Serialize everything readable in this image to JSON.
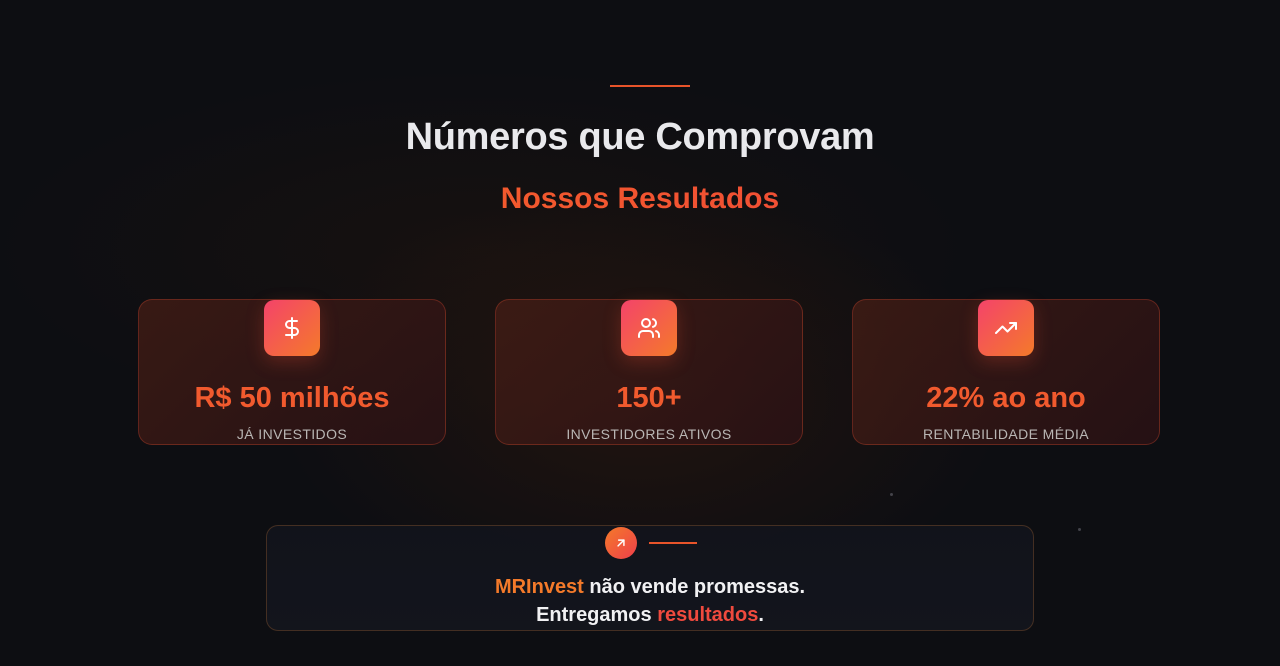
{
  "section": {
    "title": "Números que Comprovam",
    "subtitle": "Nossos Resultados"
  },
  "stats": [
    {
      "icon": "dollar-icon",
      "value": "R$ 50 milhões",
      "label": "JÁ INVESTIDOS"
    },
    {
      "icon": "users-icon",
      "value": "150+",
      "label": "INVESTIDORES ATIVOS"
    },
    {
      "icon": "trending-up-icon",
      "value": "22% ao ano",
      "label": "RENTABILIDADE MÉDIA"
    }
  ],
  "statement": {
    "icon": "arrow-up-right-icon",
    "brand": "MRInvest",
    "line1_rest": " não vende promessas.",
    "line2_start": "Entregamos ",
    "line2_highlight": "resultados",
    "line2_end": "."
  },
  "colors": {
    "accent_orange": "#f47a2a",
    "accent_red": "#ef3f3f",
    "background": "#0d0e12"
  }
}
